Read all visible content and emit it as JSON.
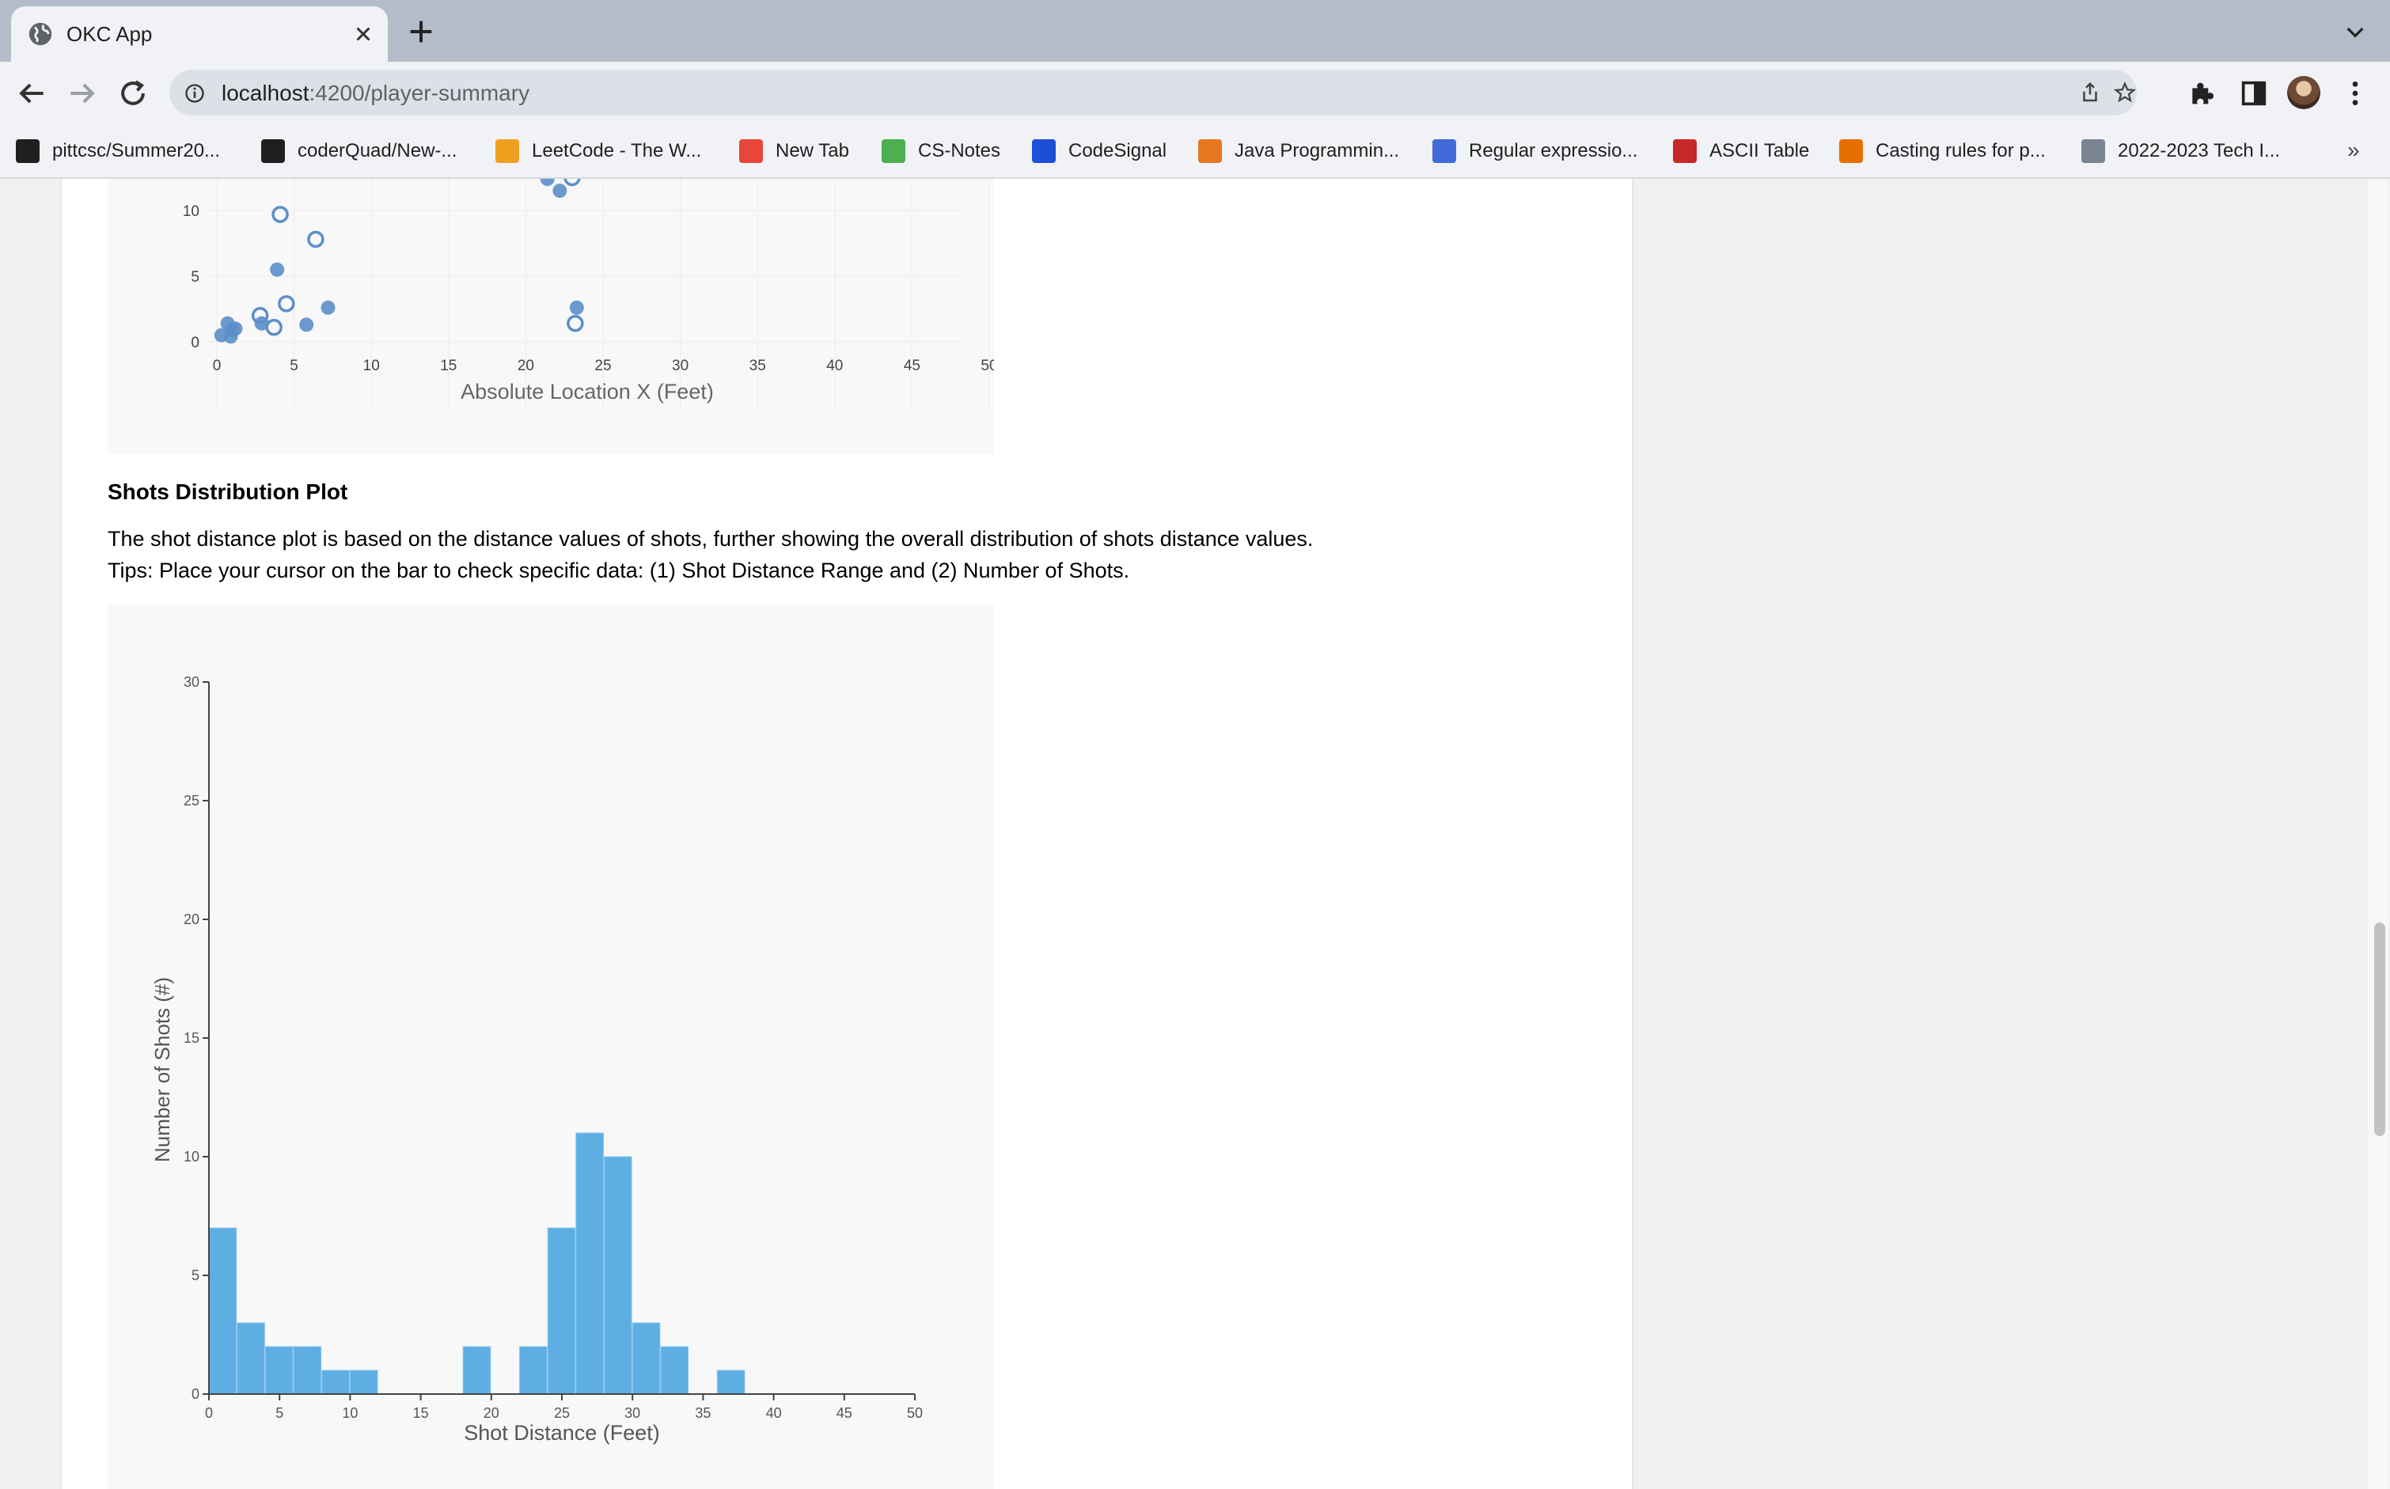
{
  "browser": {
    "tab_title": "OKC App",
    "url_host": "localhost",
    "url_path": ":4200/player-summary",
    "bookmarks": [
      {
        "label": "pittcsc/Summer20...",
        "icon": "github-icon",
        "color": "#1f1f1f"
      },
      {
        "label": "coderQuad/New-...",
        "icon": "github-icon",
        "color": "#1f1f1f"
      },
      {
        "label": "LeetCode - The W...",
        "icon": "leetcode-icon",
        "color": "#f0a020"
      },
      {
        "label": "New Tab",
        "icon": "newtab-icon",
        "color": "#e8453c"
      },
      {
        "label": "CS-Notes",
        "icon": "cs-notes-icon",
        "color": "#4caf50"
      },
      {
        "label": "CodeSignal",
        "icon": "codesignal-icon",
        "color": "#1d4ed8"
      },
      {
        "label": "Java Programmin...",
        "icon": "princeton-icon",
        "color": "#e87722"
      },
      {
        "label": "Regular expressio...",
        "icon": "regex-icon",
        "color": "#3f6ad8"
      },
      {
        "label": "ASCII Table",
        "icon": "ascii-icon",
        "color": "#c62828"
      },
      {
        "label": "Casting rules for p...",
        "icon": "java-icon",
        "color": "#e76f00"
      },
      {
        "label": "2022-2023 Tech I...",
        "icon": "chart-icon",
        "color": "#7a8591"
      }
    ],
    "more_bookmarks": "»"
  },
  "page": {
    "shots_title": "Shots Distribution Plot",
    "shots_desc": "The shot distance plot is based on the distance values of shots, further showing the overall distribution of shots distance values.",
    "shots_tip": "Tips: Place your cursor on the bar to check specific data: (1) Shot Distance Range and (2) Number of Shots."
  },
  "chart_data": [
    {
      "type": "scatter",
      "xlabel": "Absolute Location X (Feet)",
      "xlim": [
        0,
        50
      ],
      "ylim_visible": [
        0,
        10
      ],
      "x_ticks": [
        "0",
        "5",
        "10",
        "15",
        "20",
        "25",
        "30",
        "35",
        "40",
        "45",
        "50"
      ],
      "y_ticks": [
        "0",
        "5",
        "10"
      ],
      "marker_color": "#5b8ec9",
      "series": [
        {
          "marker": "filled",
          "points": [
            [
              0.3,
              0.5
            ],
            [
              0.7,
              1.4
            ],
            [
              0.9,
              0.4
            ],
            [
              1.0,
              0.9
            ],
            [
              1.2,
              1.0
            ],
            [
              3.9,
              5.5
            ],
            [
              2.9,
              1.4
            ],
            [
              5.8,
              1.3
            ],
            [
              7.2,
              2.6
            ],
            [
              22.2,
              11.5
            ],
            [
              21.4,
              12.4
            ],
            [
              23.3,
              2.6
            ]
          ]
        },
        {
          "marker": "open",
          "points": [
            [
              4.1,
              9.7
            ],
            [
              6.4,
              7.8
            ],
            [
              2.8,
              2.0
            ],
            [
              4.5,
              2.9
            ],
            [
              3.7,
              1.1
            ],
            [
              23.2,
              1.4
            ],
            [
              23.0,
              12.5
            ]
          ]
        }
      ]
    },
    {
      "type": "bar",
      "xlabel": "Shot Distance (Feet)",
      "ylabel": "Number of Shots (#)",
      "xlim": [
        0,
        50
      ],
      "ylim": [
        0,
        30
      ],
      "x_ticks": [
        "0",
        "5",
        "10",
        "15",
        "20",
        "25",
        "30",
        "35",
        "40",
        "45",
        "50"
      ],
      "y_ticks": [
        "0",
        "5",
        "10",
        "15",
        "20",
        "25",
        "30"
      ],
      "bar_color": "#5eaee3",
      "bin_width": 2,
      "bins": [
        {
          "start": 0,
          "count": 7
        },
        {
          "start": 2,
          "count": 3
        },
        {
          "start": 4,
          "count": 2
        },
        {
          "start": 6,
          "count": 2
        },
        {
          "start": 8,
          "count": 1
        },
        {
          "start": 10,
          "count": 1
        },
        {
          "start": 12,
          "count": 0
        },
        {
          "start": 14,
          "count": 0
        },
        {
          "start": 16,
          "count": 0
        },
        {
          "start": 18,
          "count": 2
        },
        {
          "start": 20,
          "count": 0
        },
        {
          "start": 22,
          "count": 2
        },
        {
          "start": 24,
          "count": 7
        },
        {
          "start": 26,
          "count": 11
        },
        {
          "start": 28,
          "count": 10
        },
        {
          "start": 30,
          "count": 3
        },
        {
          "start": 32,
          "count": 2
        },
        {
          "start": 34,
          "count": 0
        },
        {
          "start": 36,
          "count": 1
        }
      ]
    }
  ]
}
